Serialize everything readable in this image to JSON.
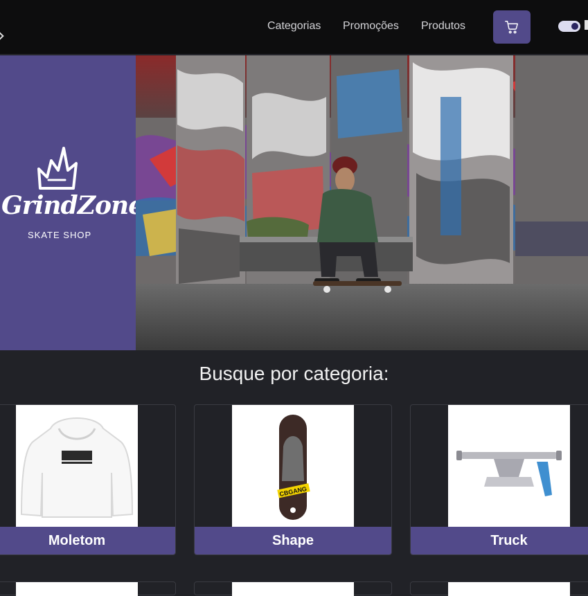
{
  "nav": {
    "links": [
      "Categorias",
      "Promoções",
      "Produtos"
    ],
    "cart_icon": "cart-icon",
    "theme_toggle": "theme-toggle-switch"
  },
  "brand": {
    "logo_icon": "crown-icon",
    "name": "GrindZone",
    "subtitle": "SKATE SHOP"
  },
  "categories": {
    "title": "Busque por categoria:",
    "items": [
      {
        "label": "Moletom",
        "icon": "hoodie-image"
      },
      {
        "label": "Shape",
        "icon": "skateboard-deck-image",
        "deck_text": "CBGANG"
      },
      {
        "label": "Truck",
        "icon": "skate-truck-image"
      }
    ]
  },
  "colors": {
    "accent": "#524a8a",
    "navbar": "#0d0d0e",
    "background": "#212227"
  }
}
